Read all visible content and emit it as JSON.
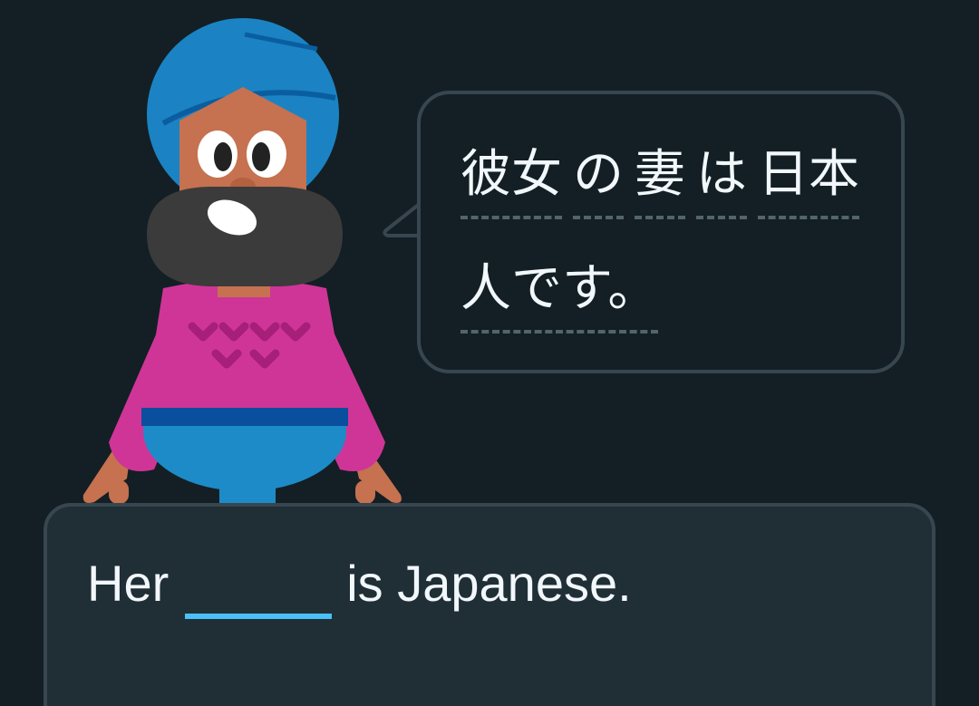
{
  "bubble": {
    "line1_words": [
      "彼女",
      "の",
      "妻",
      "は",
      "日本"
    ],
    "line2_words": [
      "人です。"
    ]
  },
  "sentence": {
    "before": "Her",
    "blank_value": "",
    "after": "is Japanese."
  },
  "colors": {
    "background": "#131f24",
    "card": "#202f36",
    "border": "#37464f",
    "blank_underline": "#49c0f8",
    "text": "#f1f7fb"
  }
}
